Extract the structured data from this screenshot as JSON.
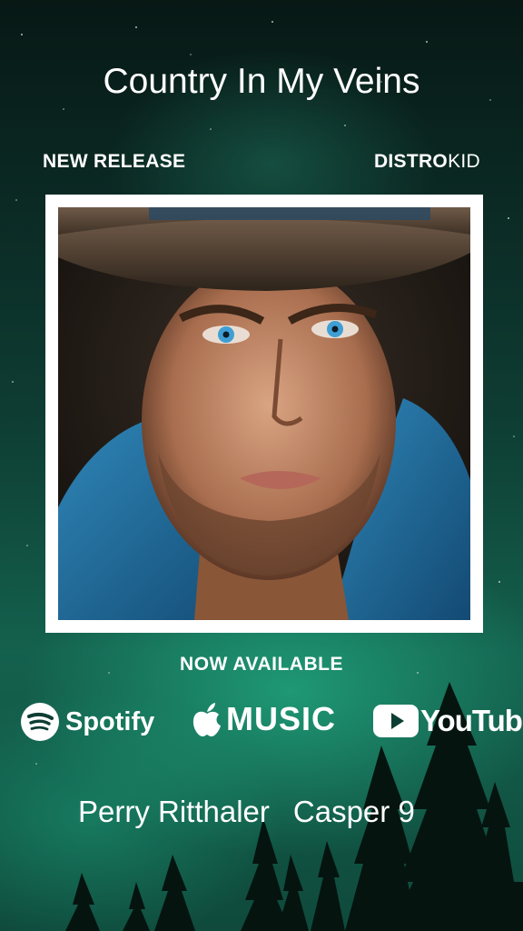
{
  "title": "Country In My Veins",
  "header": {
    "left_label": "NEW RELEASE",
    "brand_bold": "DISTRO",
    "brand_light": "KID"
  },
  "cover": {
    "description_icon": "album-cover-portrait"
  },
  "availability": {
    "label": "NOW AVAILABLE"
  },
  "platforms": {
    "spotify": {
      "label": "Spotify",
      "icon": "spotify-icon"
    },
    "apple_music": {
      "label": "MUSIC",
      "icon": "apple-icon"
    },
    "youtube": {
      "label": "YouTube",
      "icon": "youtube-play-icon"
    }
  },
  "artists": [
    "Perry Ritthaler",
    "Casper 9"
  ],
  "colors": {
    "text": "#ffffff",
    "aurora_green": "#1f8f6d",
    "sky_dark": "#071815",
    "youtube_play": "#ffffff"
  }
}
